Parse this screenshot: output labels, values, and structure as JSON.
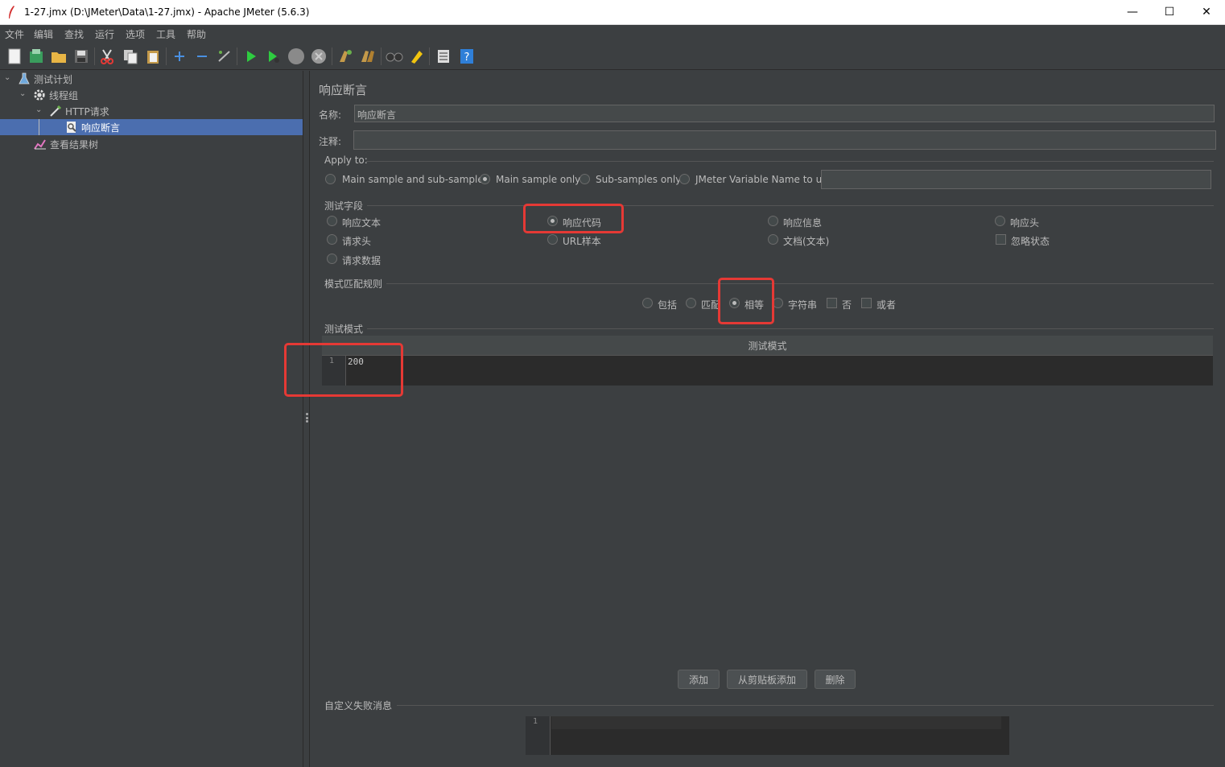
{
  "window": {
    "title": "1-27.jmx (D:\\JMeter\\Data\\1-27.jmx) - Apache JMeter (5.6.3)",
    "minimize": "—",
    "maximize": "☐",
    "close": "✕"
  },
  "menu": [
    "文件",
    "编辑",
    "查找",
    "运行",
    "选项",
    "工具",
    "帮助"
  ],
  "tree": {
    "items": [
      {
        "label": "测试计划",
        "icon": "flask-icon"
      },
      {
        "label": "线程组",
        "icon": "gear-icon"
      },
      {
        "label": "HTTP请求",
        "icon": "pipette-icon"
      },
      {
        "label": "响应断言",
        "icon": "assertion-icon",
        "selected": true
      },
      {
        "label": "查看结果树",
        "icon": "chart-icon"
      }
    ]
  },
  "panel": {
    "heading": "响应断言",
    "name_label": "名称:",
    "name_value": "响应断言",
    "comment_label": "注释:",
    "comment_value": "",
    "apply_to": {
      "label": "Apply to:",
      "options": [
        "Main sample and sub-samples",
        "Main sample only",
        "Sub-samples only",
        "JMeter Variable Name to use"
      ],
      "selected": "Main sample only",
      "variable_value": ""
    },
    "test_field": {
      "label": "测试字段",
      "options": [
        "响应文本",
        "响应代码",
        "响应信息",
        "响应头",
        "请求头",
        "URL样本",
        "文档(文本)",
        "请求数据"
      ],
      "checkbox": "忽略状态",
      "selected": "响应代码"
    },
    "match_rules": {
      "label": "模式匹配规则",
      "options": [
        "包括",
        "匹配",
        "相等",
        "字符串"
      ],
      "checks": [
        "否",
        "或者"
      ],
      "selected": "相等"
    },
    "patterns": {
      "label": "测试模式",
      "column_header": "测试模式",
      "row_number": "1",
      "value": "200"
    },
    "buttons": {
      "add": "添加",
      "add_clipboard": "从剪贴板添加",
      "delete": "删除"
    },
    "failure_message": {
      "label": "自定义失败消息",
      "row_number": "1",
      "value": ""
    }
  },
  "colors": {
    "accent": "#4b6eaf",
    "highlight": "#e53935",
    "background": "#3c3f41"
  }
}
